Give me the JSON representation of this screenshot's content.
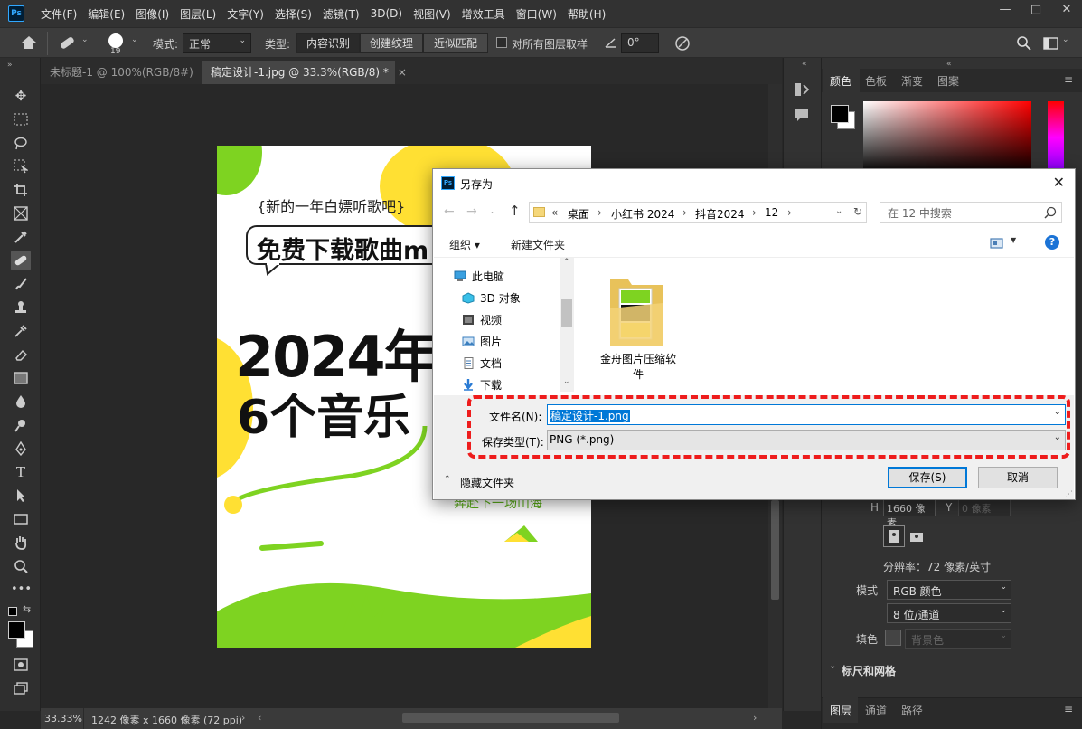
{
  "menubar": {
    "logo": "Ps",
    "items": [
      "文件(F)",
      "编辑(E)",
      "图像(I)",
      "图层(L)",
      "文字(Y)",
      "选择(S)",
      "滤镜(T)",
      "3D(D)",
      "视图(V)",
      "增效工具",
      "窗口(W)",
      "帮助(H)"
    ],
    "window_controls": [
      "—",
      "□",
      "✕"
    ]
  },
  "options": {
    "brush_size": "19",
    "mode_label": "模式:",
    "mode_value": "正常",
    "type_label": "类型:",
    "type_options": [
      "内容识别",
      "创建纹理",
      "近似匹配"
    ],
    "sample_all_label": "对所有图层取样",
    "angle_value": "0°"
  },
  "tabs": {
    "tab1": "未标题-1 @ 100%(RGB/8#)",
    "tab2": "稿定设计-1.jpg @ 33.3%(RGB/8) *",
    "close": "×"
  },
  "poster": {
    "tagline": "{新的一年白嫖听歌吧}",
    "bubble": "免费下载歌曲m",
    "headline1": "2024年",
    "headline2": "6个音乐",
    "slogan": "奔赴下一场山海"
  },
  "status": {
    "zoom": "33.33%",
    "doc_info": "1242 像素 x 1660 像素 (72 ppi)"
  },
  "panel": {
    "tabs": [
      "颜色",
      "色板",
      "渐变",
      "图案"
    ],
    "h_label": "H",
    "h_value": "1660 像素",
    "y_label": "Y",
    "y_placeholder": "0 像素",
    "resolution": "分辨率：72 像素/英寸",
    "mode_label": "模式",
    "mode_value": "RGB 颜色",
    "depth_value": "8 位/通道",
    "fill_label": "填色",
    "fill_value": "背景色",
    "section_title": "标尺和网格",
    "bottom_tabs": [
      "图层",
      "通道",
      "路径"
    ]
  },
  "dialog": {
    "title": "另存为",
    "breadcrumb": [
      "«",
      "桌面",
      "小红书 2024",
      "抖音2024",
      "12"
    ],
    "search_placeholder": "在 12 中搜索",
    "organize": "组织 ▾",
    "new_folder": "新建文件夹",
    "nav_items": [
      "此电脑",
      "3D 对象",
      "视频",
      "图片",
      "文档",
      "下载"
    ],
    "folder_name_line1": "金舟图片压缩软",
    "folder_name_line2": "件",
    "filename_label": "文件名(N):",
    "filename_value": "稿定设计-1.png",
    "filetype_label": "保存类型(T):",
    "filetype_value": "PNG (*.png)",
    "hide_folders": "隐藏文件夹",
    "save_button": "保存(S)",
    "cancel_button": "取消"
  },
  "colors": {
    "accent_green": "#7ed321",
    "accent_yellow": "#ffe033",
    "highlight_red": "#ee1c1c",
    "selection_blue": "#0078d7"
  }
}
